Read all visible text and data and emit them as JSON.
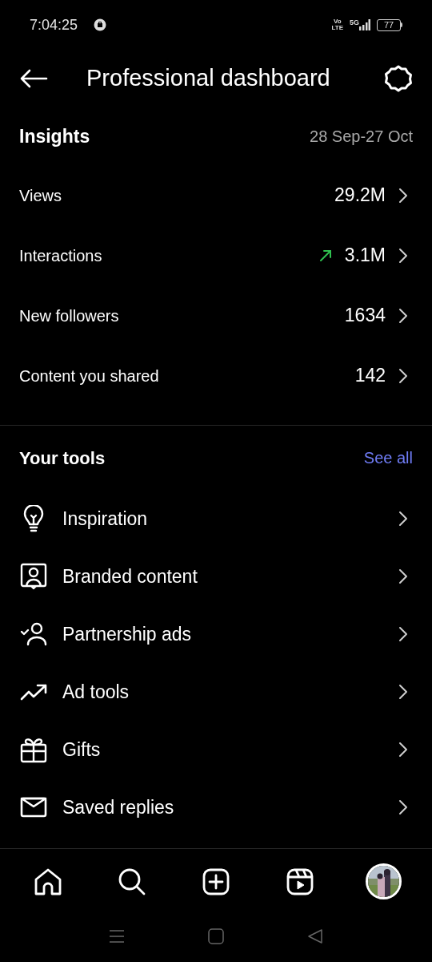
{
  "status_bar": {
    "time": "7:04:25",
    "volte_top": "Vo",
    "volte_bottom": "LTE",
    "network": "5G",
    "battery": "77"
  },
  "header": {
    "title": "Professional dashboard"
  },
  "insights": {
    "title": "Insights",
    "date_range": "28 Sep-27 Oct",
    "rows": [
      {
        "label": "Views",
        "value": "29.2M",
        "trending_up": false
      },
      {
        "label": "Interactions",
        "value": "3.1M",
        "trending_up": true
      },
      {
        "label": "New followers",
        "value": "1634",
        "trending_up": false
      },
      {
        "label": "Content you shared",
        "value": "142",
        "trending_up": false
      }
    ]
  },
  "tools": {
    "title": "Your tools",
    "see_all": "See all",
    "items": [
      {
        "label": "Inspiration"
      },
      {
        "label": "Branded content"
      },
      {
        "label": "Partnership ads"
      },
      {
        "label": "Ad tools"
      },
      {
        "label": "Gifts"
      },
      {
        "label": "Saved replies"
      }
    ]
  },
  "bottom_nav": {
    "items": [
      {
        "kind": "home"
      },
      {
        "kind": "search"
      },
      {
        "kind": "create"
      },
      {
        "kind": "reels"
      },
      {
        "kind": "profile"
      }
    ]
  }
}
